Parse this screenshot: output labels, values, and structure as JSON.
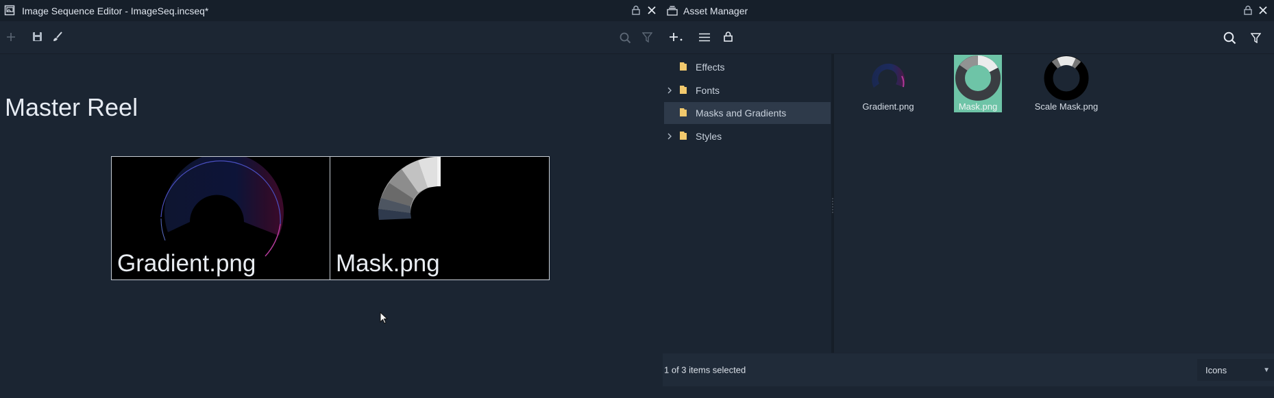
{
  "editor": {
    "title": "Image Sequence Editor - ImageSeq.incseq*",
    "reel_title": "Master Reel",
    "frames": [
      {
        "label": "Gradient.png"
      },
      {
        "label": "Mask.png"
      }
    ]
  },
  "asset_manager": {
    "title": "Asset Manager",
    "folders": [
      {
        "label": "Effects",
        "expandable": false,
        "selected": false
      },
      {
        "label": "Fonts",
        "expandable": true,
        "selected": false
      },
      {
        "label": "Masks and Gradients",
        "expandable": false,
        "selected": true
      },
      {
        "label": "Styles",
        "expandable": true,
        "selected": false
      }
    ],
    "assets": [
      {
        "label": "Gradient.png",
        "selected": false
      },
      {
        "label": "Mask.png",
        "selected": true
      },
      {
        "label": "Scale Mask.png",
        "selected": false
      }
    ],
    "status": "1 of 3 items selected",
    "view_mode": "Icons"
  },
  "colors": {
    "background": "#1b2532",
    "selection": "#6ec4a7",
    "folder": "#f2c96d"
  }
}
